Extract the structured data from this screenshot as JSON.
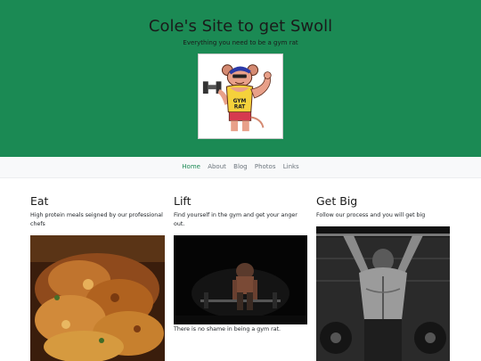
{
  "header": {
    "title": "Cole's Site to get Swoll",
    "subtitle": "Everything you need to be a gym rat",
    "logo_text": "GYM RAT",
    "logo_icon": "gym-rat-logo"
  },
  "nav": {
    "links": [
      "Home",
      "About",
      "Blog",
      "Photos",
      "Links"
    ],
    "active": "Home"
  },
  "columns": [
    {
      "title": "Eat",
      "text": "High protein meals seigned by our professional chefs",
      "image": "roast-chicken-photo"
    },
    {
      "title": "Lift",
      "text": "Find yourself in the gym and get your anger out.",
      "image": "deadlift-gym-photo",
      "caption": "There is no shame in being a gym rat."
    },
    {
      "title": "Get Big",
      "text": "Follow our process and you will get big",
      "image": "pullup-back-photo"
    }
  ],
  "colors": {
    "hero": "#1b8a54",
    "nav_bg": "#f8f9fa",
    "active_link": "#1b8a54"
  }
}
